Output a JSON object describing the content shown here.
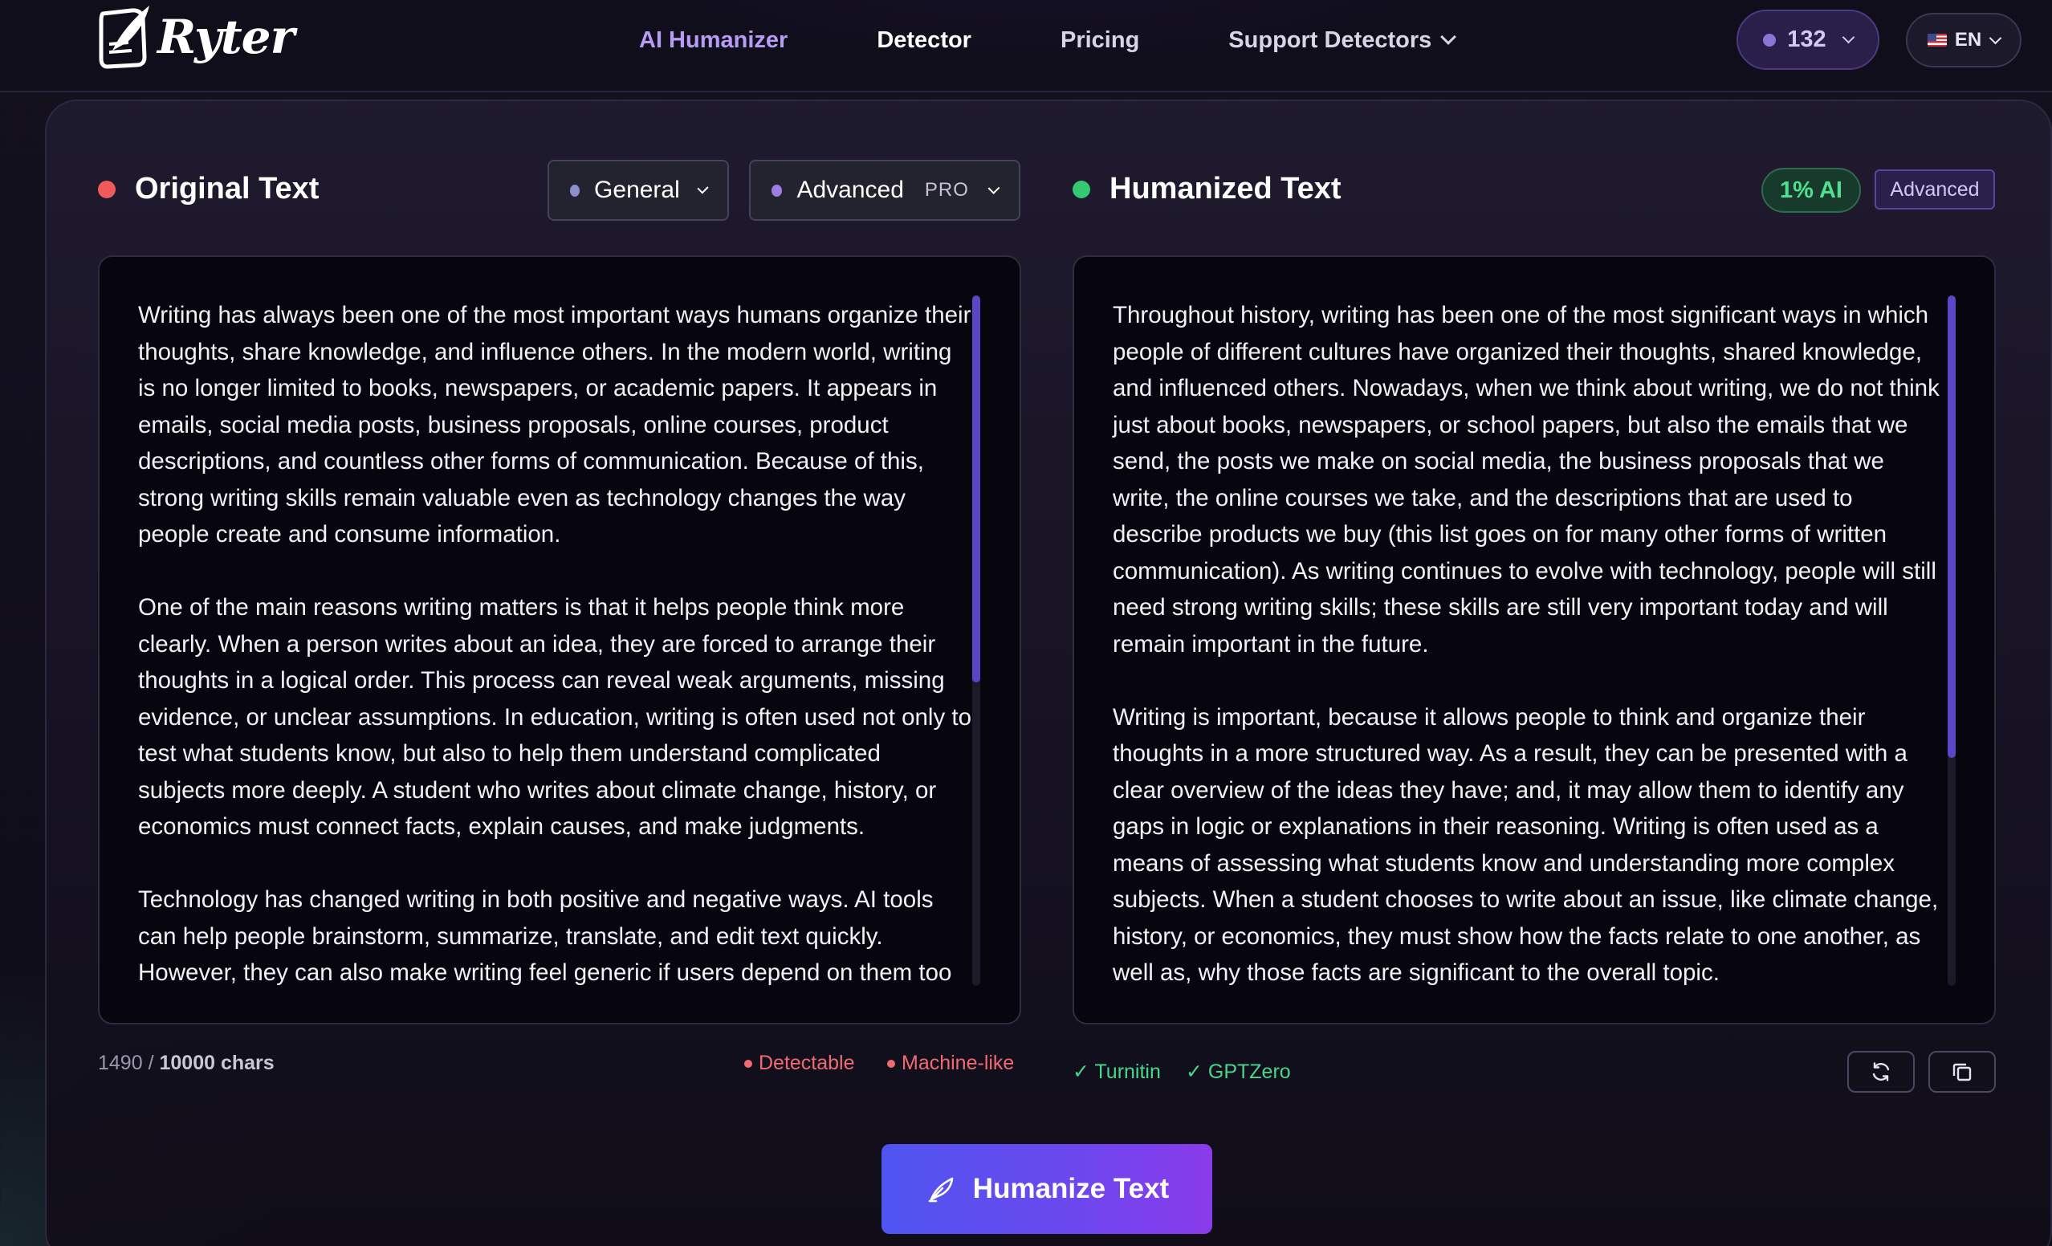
{
  "brand": {
    "name": "Ryter"
  },
  "nav": {
    "items": [
      {
        "label": "AI Humanizer"
      },
      {
        "label": "Detector"
      },
      {
        "label": "Pricing"
      },
      {
        "label": "Support Detectors"
      }
    ],
    "credits": "132",
    "language": "EN"
  },
  "colors": {
    "accent": "#b69cf5",
    "original_dot": "#f05a5a",
    "humanized_dot": "#34c870",
    "warning": "#f06a72",
    "success": "#46d88a",
    "cta_start": "#4f55f0",
    "cta_end": "#8a3bea"
  },
  "original": {
    "title": "Original Text",
    "mode_label": "General",
    "level_label": "Advanced",
    "level_badge": "PRO",
    "paragraphs": [
      "Writing has always been one of the most important ways humans organize their thoughts, share knowledge, and influence others. In the modern world, writing is no longer limited to books, newspapers, or academic papers. It appears in emails, social media posts, business proposals, online courses, product descriptions, and countless other forms of communication. Because of this, strong writing skills remain valuable even as technology changes the way people create and consume information.",
      "One of the main reasons writing matters is that it helps people think more clearly. When a person writes about an idea, they are forced to arrange their thoughts in a logical order. This process can reveal weak arguments, missing evidence, or unclear assumptions. In education, writing is often used not only to test what students know, but also to help them understand complicated subjects more deeply. A student who writes about climate change, history, or economics must connect facts, explain causes, and make judgments.",
      "Technology has changed writing in both positive and negative ways. AI tools can help people brainstorm, summarize, translate, and edit text quickly. However, they can also make writing feel generic if users depend on them too"
    ],
    "char_count": "1490",
    "char_limit": "10000 chars",
    "tags": [
      "Detectable",
      "Machine-like"
    ]
  },
  "humanized": {
    "title": "Humanized Text",
    "ai_score": "1% AI",
    "mode_badge": "Advanced",
    "paragraphs": [
      "Throughout history, writing has been one of the most significant ways in which people of different cultures have organized their thoughts, shared knowledge, and influenced others. Nowadays, when we think about writing, we do not think just about books, newspapers, or school papers, but also the emails that we send, the posts we make on social media, the business proposals that we write, the online courses we take, and the descriptions that are used to describe products we buy (this list goes on for many other forms of written communication). As writing continues to evolve with technology, people will still need strong writing skills; these skills are still very important today and will remain important in the future.",
      "Writing is important, because it allows people to think and organize their thoughts in a more structured way. As a result, they can be presented with a clear overview of the ideas they have; and, it may allow them to identify any gaps in logic or explanations in their reasoning. Writing is often used as a means of assessing what students know and understanding more complex subjects. When a student chooses to write about an issue, like climate change, history, or economics, they must show how the facts relate to one another, as well as, why those facts are significant to the overall topic."
    ],
    "checks": [
      "✓ Turnitin",
      "✓ GPTZero"
    ]
  },
  "actions": {
    "humanize_label": "Humanize Text"
  },
  "scroll": {
    "original_visible_fraction": 0.56,
    "humanized_visible_fraction": 0.67
  }
}
